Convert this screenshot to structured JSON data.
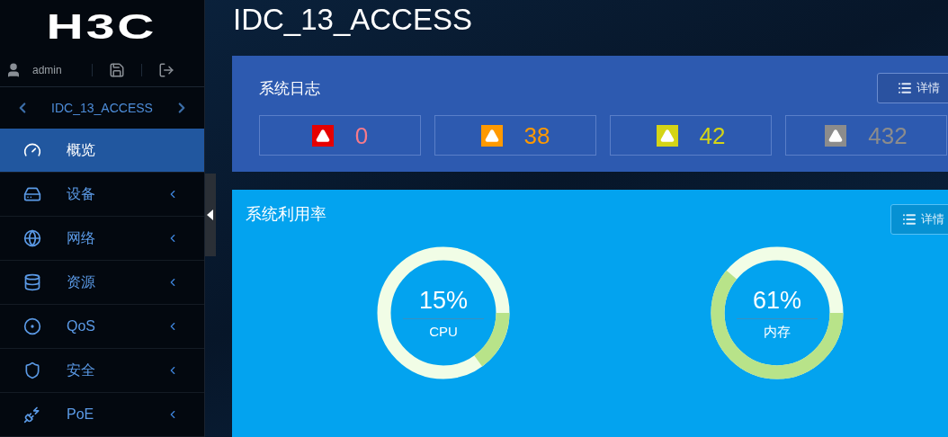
{
  "sidebar": {
    "logo": "H3C",
    "user": "admin",
    "device": "IDC_13_ACCESS",
    "items": [
      {
        "label": "概览",
        "selected": true,
        "expandable": false
      },
      {
        "label": "设备",
        "selected": false,
        "expandable": true
      },
      {
        "label": "网络",
        "selected": false,
        "expandable": true
      },
      {
        "label": "资源",
        "selected": false,
        "expandable": true
      },
      {
        "label": "QoS",
        "selected": false,
        "expandable": true
      },
      {
        "label": "安全",
        "selected": false,
        "expandable": true
      },
      {
        "label": "PoE",
        "selected": false,
        "expandable": true
      }
    ]
  },
  "page_title": "IDC_13_ACCESS",
  "system_log": {
    "title": "系统日志",
    "details_button": "详情",
    "counts": [
      {
        "value": "0",
        "color": "#e60000"
      },
      {
        "value": "38",
        "color": "#ff9900"
      },
      {
        "value": "42",
        "color": "#d4d416"
      },
      {
        "value": "432",
        "color": "#8c8c8c"
      }
    ]
  },
  "system_usage": {
    "title": "系统利用率",
    "details_button": "详情",
    "gauges": [
      {
        "reading": "15%",
        "label": "CPU",
        "level": 0.15
      },
      {
        "reading": "61%",
        "label": "内存",
        "level": 0.61
      }
    ]
  }
}
